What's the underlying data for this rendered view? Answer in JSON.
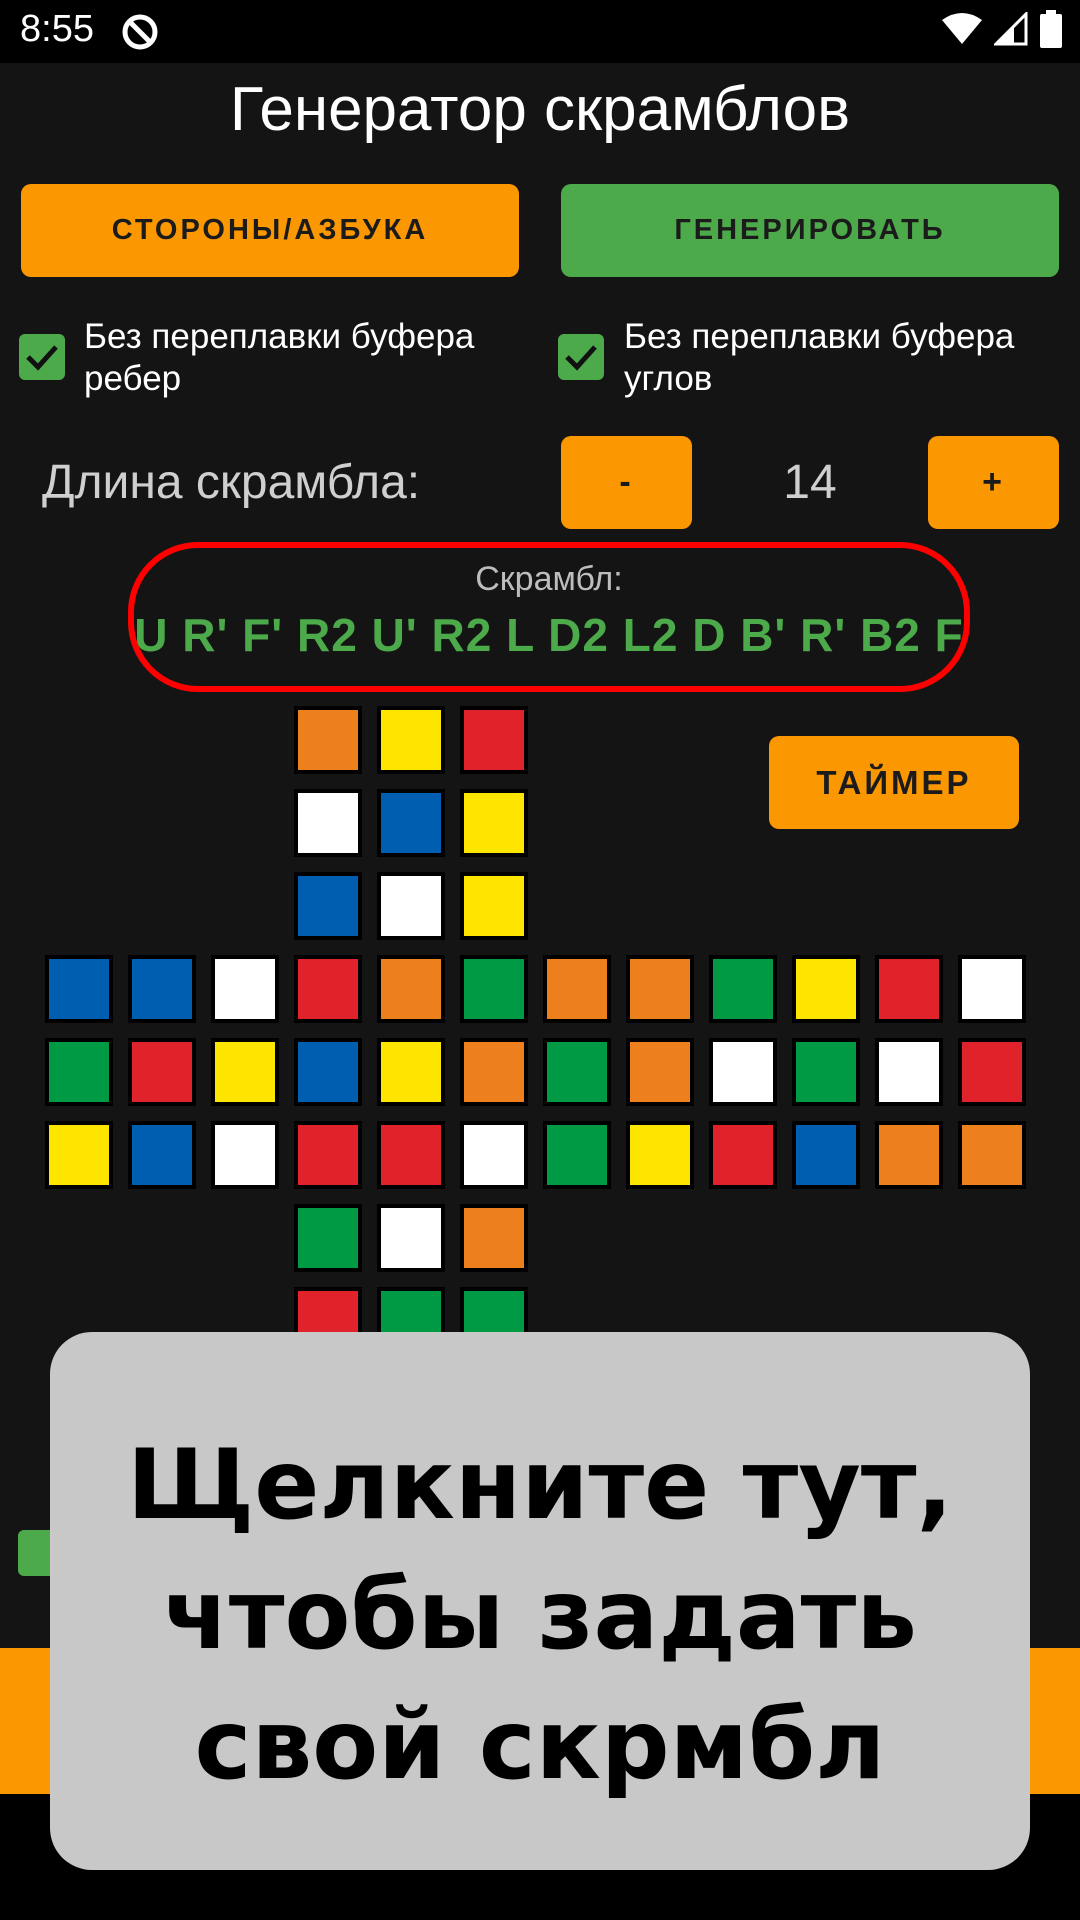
{
  "status_bar": {
    "time": "8:55"
  },
  "header": {
    "title": "Генератор скрамблов"
  },
  "buttons": {
    "sides_alphabet": "СТОРОНЫ/АЗБУКА",
    "generate": "ГЕНЕРИРОВАТЬ",
    "minus": "-",
    "plus": "+",
    "timer": "ТАЙМЕР"
  },
  "options": {
    "edges_buffer": {
      "label": "Без переплавки буфера ребер",
      "checked": true
    },
    "corners_buffer": {
      "label": "Без переплавки буфера углов",
      "checked": true
    }
  },
  "length": {
    "label": "Длина скрамбла:",
    "value": "14"
  },
  "scramble": {
    "caption": "Скрамбл:",
    "text": "U R' F' R2 U' R2 L D2 L2 D B' R' B2 F"
  },
  "colors": {
    "orange": "#ee7f1d",
    "yellow": "#fde500",
    "red": "#e0222a",
    "white": "#ffffff",
    "blue": "#005eb0",
    "green": "#019a44",
    "accent_orange": "#fb9700",
    "accent_green": "#4caa4a"
  },
  "cube_net": {
    "up": [
      [
        "orange",
        "yellow",
        "red"
      ],
      [
        "white",
        "blue",
        "yellow"
      ],
      [
        "blue",
        "white",
        "yellow"
      ]
    ],
    "middle": [
      [
        "blue",
        "blue",
        "white",
        "red",
        "orange",
        "green",
        "orange",
        "orange",
        "green",
        "yellow",
        "red",
        "white"
      ],
      [
        "green",
        "red",
        "yellow",
        "blue",
        "yellow",
        "orange",
        "green",
        "orange",
        "white",
        "green",
        "white",
        "red"
      ],
      [
        "yellow",
        "blue",
        "white",
        "red",
        "red",
        "white",
        "green",
        "yellow",
        "red",
        "blue",
        "orange",
        "orange"
      ]
    ],
    "down": [
      [
        "green",
        "white",
        "orange"
      ],
      [
        "red",
        "green",
        "green"
      ]
    ]
  },
  "tooltip": {
    "text": "Щелкните тут, чтобы задать свой скрмбл"
  }
}
